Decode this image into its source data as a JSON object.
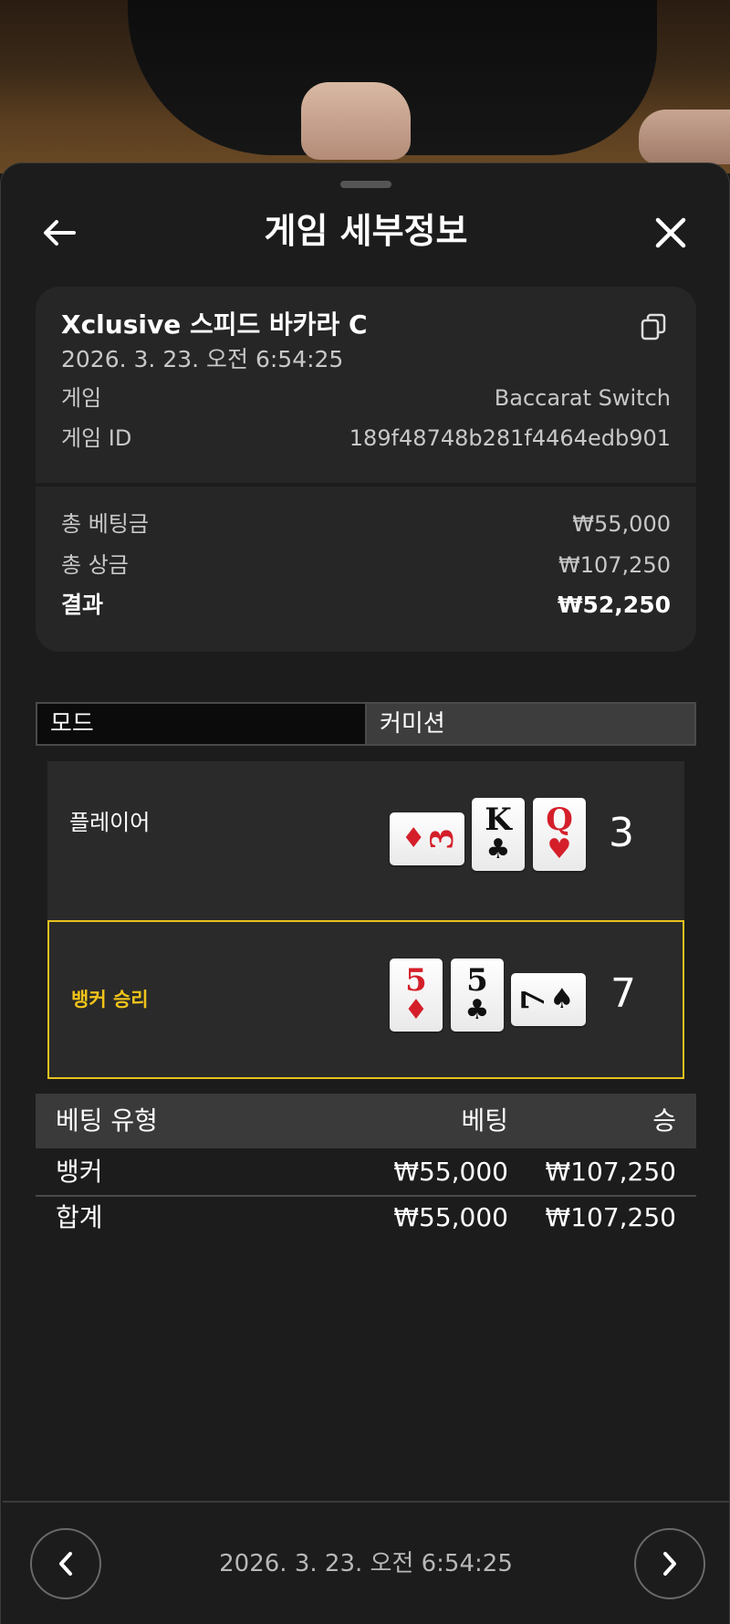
{
  "header": {
    "title": "게임 세부정보"
  },
  "info": {
    "table_name": "Xclusive 스피드 바카라 C",
    "datetime": "2026. 3. 23. 오전 6:54:25",
    "game_label": "게임",
    "game_value": "Baccarat Switch",
    "game_id_label": "게임 ID",
    "game_id_value": "189f48748b281f4464edb901",
    "total_bet_label": "총 베팅금",
    "total_bet_value": "₩55,000",
    "total_win_label": "총 상금",
    "total_win_value": "₩107,250",
    "result_label": "결과",
    "result_value": "₩52,250"
  },
  "tabs": [
    {
      "label": "모드",
      "active": true
    },
    {
      "label": "커미션",
      "active": false
    }
  ],
  "hands": {
    "player": {
      "label": "플레이어",
      "score": "3",
      "cards": [
        {
          "rank": "3",
          "suit": "♦",
          "color": "red",
          "orientation": "sideways"
        },
        {
          "rank": "K",
          "suit": "♣",
          "color": "black",
          "orientation": "upright"
        },
        {
          "rank": "Q",
          "suit": "♥",
          "color": "red",
          "orientation": "upright"
        }
      ]
    },
    "banker": {
      "label": "뱅커 승리",
      "score": "7",
      "highlight_color": "#e8c21e",
      "cards": [
        {
          "rank": "5",
          "suit": "♦",
          "color": "red",
          "orientation": "upright"
        },
        {
          "rank": "5",
          "suit": "♣",
          "color": "black",
          "orientation": "upright"
        },
        {
          "rank": "7",
          "suit": "♠",
          "color": "black",
          "orientation": "sideways"
        }
      ]
    }
  },
  "bets": {
    "headers": {
      "type": "베팅 유형",
      "bet": "베팅",
      "win": "승"
    },
    "rows": [
      {
        "type": "뱅커",
        "bet": "₩55,000",
        "win": "₩107,250"
      }
    ],
    "total": {
      "type": "합계",
      "bet": "₩55,000",
      "win": "₩107,250"
    }
  },
  "footer": {
    "datetime": "2026. 3. 23. 오전 6:54:25"
  },
  "icons": {
    "back": "arrow-left-icon",
    "close": "close-icon",
    "copy": "copy-icon",
    "prev": "chevron-left-icon",
    "next": "chevron-right-icon"
  }
}
